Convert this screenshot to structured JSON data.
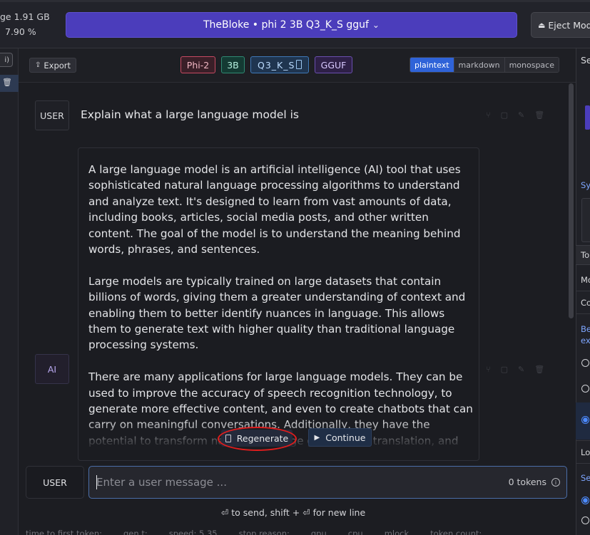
{
  "topbar": {
    "ram_label": "ge  1.91 GB",
    "cpu_label": "7.90 %",
    "model_name": "TheBloke • phi 2 3B Q3_K_S gguf",
    "eject_label": "Eject Model"
  },
  "left_sidebar": {
    "chip_text": "i)"
  },
  "chat_header": {
    "export_label": "Export",
    "tags": {
      "arch": "Phi-2",
      "size": "3B",
      "quant": "Q3_K_S",
      "format": "GGUF"
    },
    "format_options": [
      "plaintext",
      "markdown",
      "monospace"
    ],
    "format_selected": "plaintext"
  },
  "messages": {
    "user": {
      "role": "USER",
      "text": "Explain what a large language model is"
    },
    "ai": {
      "role": "AI",
      "paragraphs": [
        " A large language model is an artificial intelligence (AI) tool that uses sophisticated natural language processing algorithms to understand and analyze text. It's designed to learn from vast amounts of data, including books, articles, social media posts, and other written content. The goal of the model is to understand the meaning behind words, phrases, and sentences.",
        "Large models are typically trained on large datasets that contain billions of words, giving them a greater understanding of context and enabling them to better identify nuances in language. This allows them to generate text with higher quality than traditional language processing systems.",
        "There are many applications for large language models. They can be used to improve the accuracy of speech recognition technology, to generate more effective content, and even to create chatbots that can carry on meaningful conversations. Additionally, they have the potential to transform natural language generation, translation, and"
      ]
    }
  },
  "actions": {
    "regenerate": "Regenerate",
    "continue": "Continue"
  },
  "input": {
    "role": "USER",
    "placeholder": "Enter a user message ...",
    "value": "",
    "tokens": "0 tokens",
    "hint": "⏎ to send, shift + ⏎ for new line"
  },
  "stats": [
    "time to first token:",
    "gen t:",
    "speed: 5.35",
    "stop reason:",
    "gpu",
    "cpu",
    "mlock",
    "token count:"
  ],
  "right_panel": {
    "header": "Se",
    "items": [
      "Sy",
      "To",
      "Mo",
      "Co",
      "Be",
      "ex",
      "Lo",
      "Se"
    ]
  },
  "colors": {
    "accent": "#4b3dbb",
    "selected_format": "#2f63d8",
    "input_border": "#4b6ea8",
    "annotation_circle": "#e01d1d"
  }
}
